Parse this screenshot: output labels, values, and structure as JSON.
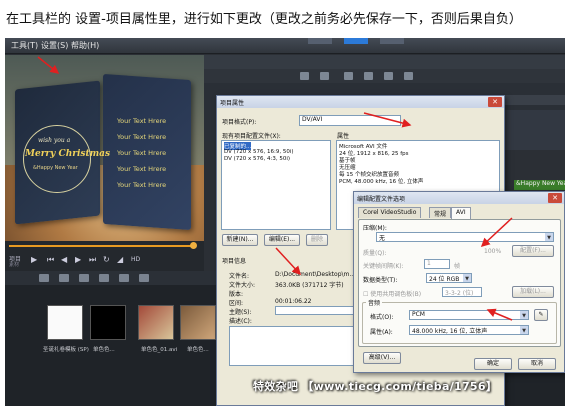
{
  "caption": "在工具栏的 设置-项目属性里，进行如下更改（更改之前务必先保存一下，否则后果自负）",
  "menubar": {
    "items": [
      "工具(T)",
      "设置(S)",
      "帮助(H)"
    ]
  },
  "preview": {
    "wish": "wish you a",
    "title": "Merry Christmas",
    "subtitle": "&Happy New Year",
    "your_text": [
      "Your Text Hrere",
      "Your Text Hrere",
      "Your Text Hrere",
      "Your Text Hrere",
      "Your Text Hrere"
    ]
  },
  "playback": {
    "label_top": "项目",
    "label_bottom": "素材",
    "hd": "HD"
  },
  "library": {
    "thumbs": [
      {
        "label": "圣诞礼卷模板 (SP)"
      },
      {
        "label": "单色色..."
      },
      {
        "label": "单色色..."
      },
      {
        "label": "单色色_01.avi"
      },
      {
        "label": "单色色..."
      }
    ]
  },
  "timeline_clip": "&Happy New Year",
  "project_dialog": {
    "title": "项目属性",
    "format_label": "项目格式(P):",
    "format_value": "DV/AVI",
    "existing_label": "现有项目配置文件(X):",
    "profiles": [
      "已复制的...",
      "DV (720 x 576, 16:9, 50i)",
      "DV (720 x 576, 4:3, 50i)"
    ],
    "attr_label": "属性",
    "attr_lines": [
      "Microsoft AVI 文件",
      "24 位, 1912 x 816, 25 fps",
      "基于帧",
      "无压缩",
      "每 15 个帧交织放置音频",
      "PCM, 48.000 kHz, 16 位, 立体声"
    ],
    "new_btn": "新建(N)...",
    "edit_btn": "编辑(E)...",
    "delete_btn": "删除",
    "info_label": "项目信息",
    "info_rows": [
      {
        "k": "文件名:",
        "v": "D:\\Document\\Desktop\\m..."
      },
      {
        "k": "文件大小:",
        "v": "363.0KB (371712 字节)"
      },
      {
        "k": "版本:",
        "v": ""
      },
      {
        "k": "区间:",
        "v": "00:01:06.22"
      },
      {
        "k": "主题(S):",
        "v": ""
      },
      {
        "k": "描述(C):",
        "v": ""
      }
    ]
  },
  "profile_dialog": {
    "title": "编辑配置文件选项",
    "tabs": [
      "Corel VideoStudio",
      "常规",
      "AVI"
    ],
    "compression_label": "压缩(M):",
    "compression_value": "无",
    "quality_label": "质量(Q):",
    "quality_pct": "100%",
    "config_btn": "配置(F)...",
    "keyframe_label": "关键帧间隔(K):",
    "keyframe_value": "1",
    "keyframe_unit": "帧",
    "format_label": "数据类型(T):",
    "format_value": "24 位 RGB",
    "use_label": "使用共用调色板(B)",
    "use_value": "3-3-2 (位)",
    "load_btn": "加载(L)...",
    "audio_group": "音频",
    "audio_format_label": "格式(O):",
    "audio_format_value": "PCM",
    "audio_attr_label": "属性(A):",
    "audio_attr_value": "48.000 kHz, 16 位, 立体声",
    "advanced_btn": "高级(V)...",
    "ok_btn": "确定",
    "cancel_btn": "取消"
  },
  "watermark": "特效杂吧 【www.tiecg.com/tieba/1756】",
  "colors": {
    "annotation_arrow": "#e02020",
    "accent": "#e89a22",
    "selection": "#316ac5"
  }
}
